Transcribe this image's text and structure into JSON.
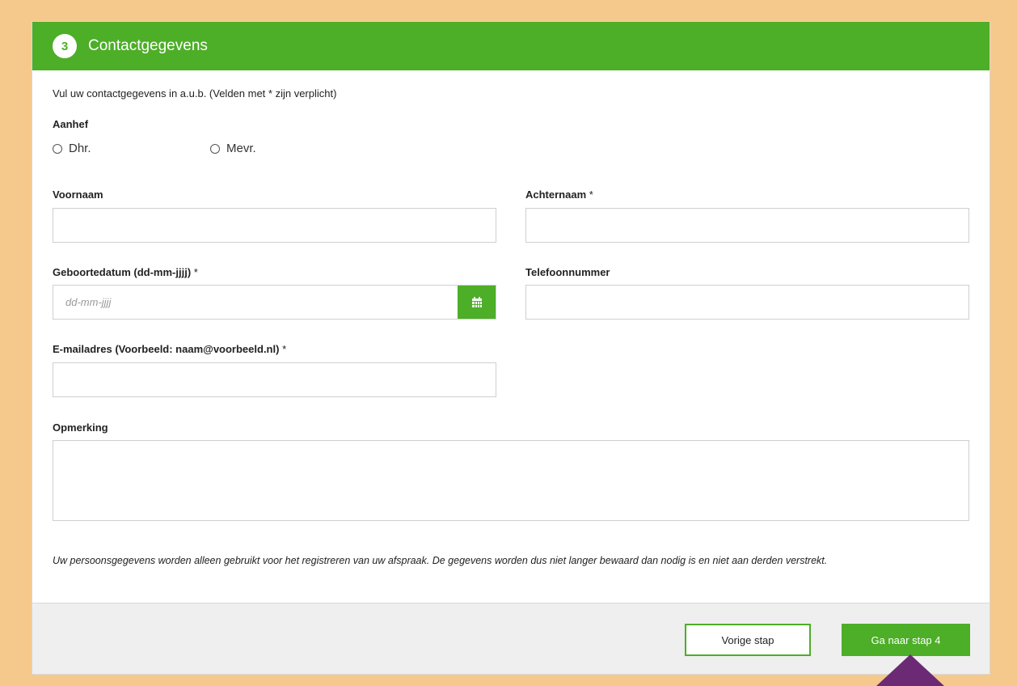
{
  "colors": {
    "accent": "#4dae28",
    "frame": "#f5c98c",
    "pointer": "#6b2a73"
  },
  "header": {
    "step": "3",
    "title": "Contactgegevens"
  },
  "form": {
    "intro": "Vul uw contactgegevens in a.u.b. (Velden met * zijn verplicht)",
    "salutation": {
      "label": "Aanhef",
      "options": [
        "Dhr.",
        "Mevr."
      ],
      "selected": ""
    },
    "first_name": {
      "label": "Voornaam",
      "value": ""
    },
    "last_name": {
      "label": "Achternaam",
      "required": "*",
      "value": ""
    },
    "birthdate": {
      "label": "Geboortedatum (dd-mm-jjjj)",
      "required": "*",
      "placeholder": "dd-mm-jjjj",
      "icon": "calendar-icon"
    },
    "phone": {
      "label": "Telefoonnummer",
      "value": ""
    },
    "email": {
      "label": "E-mailadres (Voorbeeld: naam@voorbeeld.nl)",
      "required": "*",
      "value": ""
    },
    "remark": {
      "label": "Opmerking",
      "value": ""
    },
    "privacy": "Uw persoonsgegevens worden alleen gebruikt voor het registreren van uw afspraak. De gegevens worden dus niet langer bewaard dan nodig is en niet aan derden verstrekt."
  },
  "footer": {
    "prev_label": "Vorige stap",
    "next_label": "Ga naar stap 4"
  }
}
